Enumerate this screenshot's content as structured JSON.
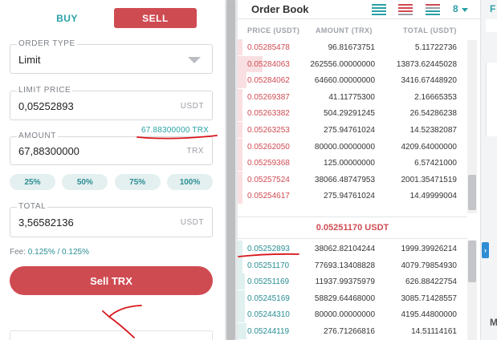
{
  "trade": {
    "tabs": {
      "buy": "BUY",
      "sell": "SELL",
      "active": "sell"
    },
    "order_type": {
      "label": "ORDER TYPE",
      "value": "Limit"
    },
    "limit_price": {
      "label": "LIMIT PRICE",
      "value": "0,05252893",
      "unit": "USDT"
    },
    "amount": {
      "label": "AMOUNT",
      "value": "67,88300000",
      "unit": "TRX",
      "available": "67.88300000 TRX"
    },
    "percent_buttons": [
      "25%",
      "50%",
      "75%",
      "100%"
    ],
    "total": {
      "label": "TOTAL",
      "value": "3,56582136",
      "unit": "USDT"
    },
    "fee": {
      "label": "Fee:",
      "value": "0.125% / 0.125%"
    },
    "submit_label": "Sell TRX"
  },
  "order_book": {
    "title": "Order Book",
    "depth": "8",
    "columns": {
      "price": "PRICE (USDT)",
      "amount": "AMOUNT (TRX)",
      "total": "TOTAL (USDT)"
    },
    "asks": [
      {
        "price": "0.05285478",
        "amount": "96.81673751",
        "total": "5.11722736",
        "depth": 0.02
      },
      {
        "price": "0.05284063",
        "amount": "262556.00000000",
        "total": "13873.62445028",
        "depth": 0.11
      },
      {
        "price": "0.05284062",
        "amount": "64660.00000000",
        "total": "3416.67448920",
        "depth": 0.04
      },
      {
        "price": "0.05269387",
        "amount": "41.11775300",
        "total": "2.16665353",
        "depth": 0.02
      },
      {
        "price": "0.05263382",
        "amount": "504.29291245",
        "total": "26.54286238",
        "depth": 0.02
      },
      {
        "price": "0.05263253",
        "amount": "275.94761024",
        "total": "14.52382087",
        "depth": 0.02
      },
      {
        "price": "0.05262050",
        "amount": "80000.00000000",
        "total": "4209.64000000",
        "depth": 0.02
      },
      {
        "price": "0.05259368",
        "amount": "125.00000000",
        "total": "6.57421000",
        "depth": 0.02
      },
      {
        "price": "0.05257524",
        "amount": "38066.48747953",
        "total": "2001.35471519",
        "depth": 0.02
      },
      {
        "price": "0.05254617",
        "amount": "275.94761024",
        "total": "14.49999004",
        "depth": 0.02
      }
    ],
    "spread_price": "0.05251170 USDT",
    "bids": [
      {
        "price": "0.05252893",
        "amount": "38062.82104244",
        "total": "1999.39926214",
        "depth": 0.02
      },
      {
        "price": "0.05251170",
        "amount": "77693.13408828",
        "total": "4079.79854930",
        "depth": 0.02
      },
      {
        "price": "0.05251169",
        "amount": "11937.99375979",
        "total": "626.88422754",
        "depth": 0.03
      },
      {
        "price": "0.05245169",
        "amount": "58829.64468000",
        "total": "3085.71428557",
        "depth": 0.03
      },
      {
        "price": "0.05244310",
        "amount": "80000.00000000",
        "total": "4195.44800000",
        "depth": 0.03
      },
      {
        "price": "0.05244119",
        "amount": "276.71266816",
        "total": "14.51114161",
        "depth": 0.04
      }
    ]
  },
  "side_panel": {
    "toggle": "›",
    "top_letter": "F",
    "bottom_letter": "M"
  },
  "colors": {
    "sell": "#cf4b52",
    "buy": "#2aa1a6",
    "annotation": "#d8151b"
  }
}
